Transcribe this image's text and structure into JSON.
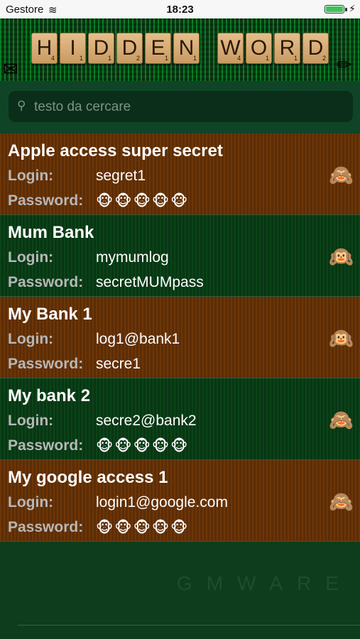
{
  "status": {
    "carrier": "Gestore",
    "time": "18:23",
    "bolt": "⚡",
    "wifi": "≋"
  },
  "header": {
    "word1": [
      "H",
      "I",
      "D",
      "D",
      "E",
      "N"
    ],
    "word2": [
      "W",
      "O",
      "R",
      "D"
    ],
    "points1": [
      "4",
      "1",
      "1",
      "2",
      "1",
      "1"
    ],
    "points2": [
      "4",
      "1",
      "1",
      "2"
    ],
    "envelope": "✉",
    "pencil": "✏"
  },
  "search": {
    "placeholder": "testo da cercare",
    "value": ""
  },
  "labels": {
    "login": "Login:",
    "password": "Password:"
  },
  "entries": [
    {
      "title": "Apple access super secret",
      "login": "segret1",
      "password": "🐵🐵🐵🐵🐵",
      "monkey": "🙈",
      "hidden": true
    },
    {
      "title": "Mum Bank",
      "login": "mymumlog",
      "password": "secretMUMpass",
      "monkey": "🙉",
      "hidden": false
    },
    {
      "title": "My Bank 1",
      "login": "log1@bank1",
      "password": "secre1",
      "monkey": "🙉",
      "hidden": false
    },
    {
      "title": "My bank 2",
      "login": "secre2@bank2",
      "password": "🐵🐵🐵🐵🐵",
      "monkey": "🙈",
      "hidden": true
    },
    {
      "title": "My google access 1",
      "login": "login1@google.com",
      "password": "🐵🐵🐵🐵🐵",
      "monkey": "🙈",
      "hidden": true
    }
  ],
  "watermark": "GMWARE",
  "colors": {
    "brown_row": "#6e3607",
    "green_row": "#0b4418",
    "background": "#0d3d1c"
  }
}
